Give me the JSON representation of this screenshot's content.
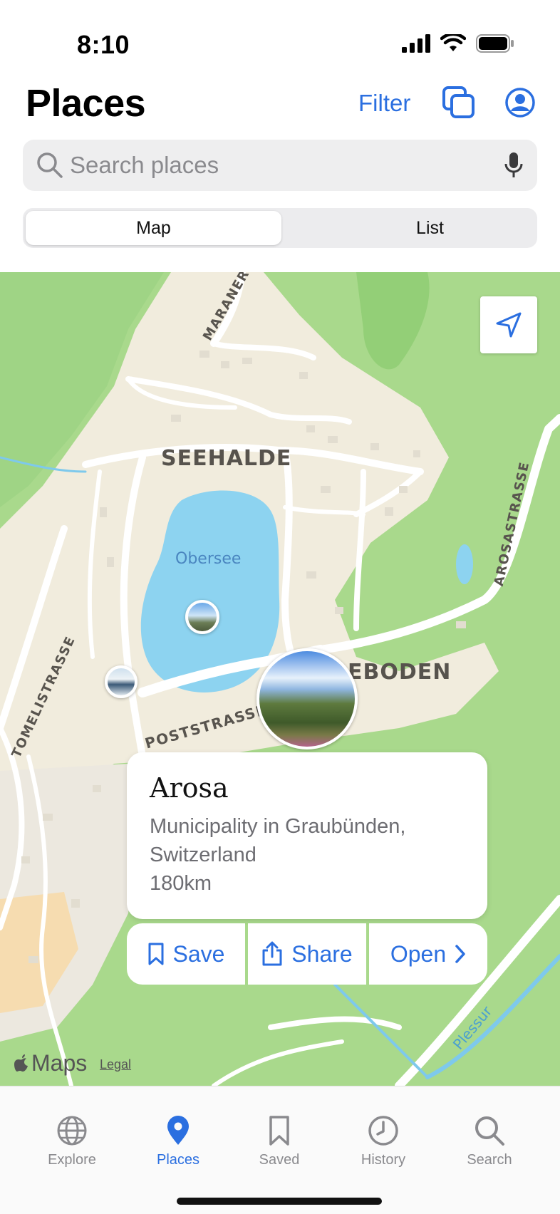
{
  "status": {
    "time": "8:10"
  },
  "header": {
    "title": "Places",
    "filter_label": "Filter"
  },
  "search": {
    "placeholder": "Search places"
  },
  "segment": {
    "options": [
      "Map",
      "List"
    ],
    "selected": "Map"
  },
  "map": {
    "labels": {
      "seehalde": "SEEHALDE",
      "eboden": "EBODEN",
      "obersee": "Obersee",
      "maranerstrasse": "MARANERSTRASSE",
      "arosastrasse": "AROSASTRASSE",
      "tomelistrasse": "TOMELISTRASSE",
      "poststrasse": "POSTSTRASSE",
      "plessur": "Plessur"
    },
    "attribution": "Maps",
    "legal": "Legal"
  },
  "card": {
    "name": "Arosa",
    "description": "Municipality in Graubünden, Switzerland",
    "distance": "180km"
  },
  "actions": {
    "save": "Save",
    "share": "Share",
    "open": "Open"
  },
  "tabs": [
    {
      "label": "Explore",
      "icon": "globe-icon"
    },
    {
      "label": "Places",
      "icon": "pin-icon"
    },
    {
      "label": "Saved",
      "icon": "bookmark-icon"
    },
    {
      "label": "History",
      "icon": "clock-icon"
    },
    {
      "label": "Search",
      "icon": "search-icon"
    }
  ],
  "active_tab": "Places",
  "colors": {
    "accent": "#2b6fe0",
    "water": "#8dd3f0",
    "park": "#a9d98c",
    "land": "#f1ecdd"
  }
}
